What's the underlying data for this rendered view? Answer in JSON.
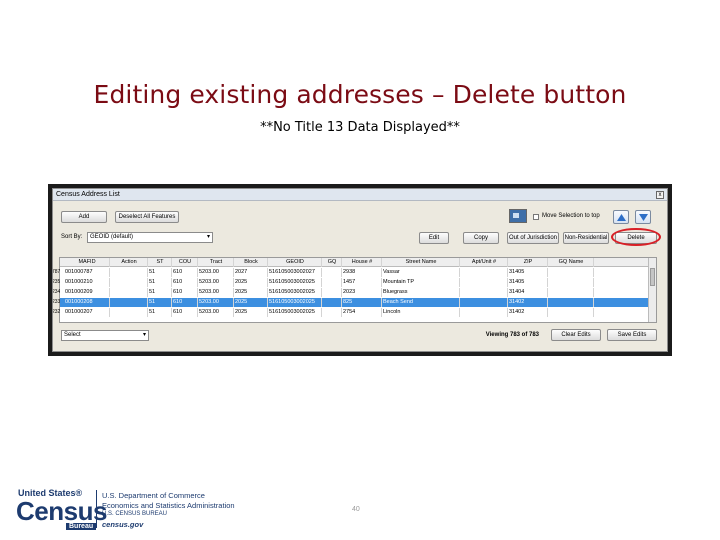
{
  "slide": {
    "title": "Editing existing addresses – Delete button",
    "subtitle": "**No Title 13 Data Displayed**",
    "page_number": "40"
  },
  "window": {
    "title": "Census Address List",
    "close_glyph": "x"
  },
  "toolbar": {
    "add_label": "Add",
    "deselect_label": "Deselect All Features",
    "move_to_top_label": "Move Selection to top",
    "sort_by_label": "Sort By:",
    "sort_by_value": "GEOID (default)",
    "edit_label": "Edit",
    "copy_label": "Copy",
    "out_of_jurisdiction_label": "Out of Jurisdiction",
    "non_residential_label": "Non-Residential",
    "delete_label": "Delete"
  },
  "grid": {
    "columns": [
      "MAFID",
      "Action",
      "ST",
      "COU",
      "Tract",
      "Block",
      "GEOID",
      "GQ",
      "House #",
      "Street Name",
      "Apt/Unit #",
      "ZIP",
      "GQ Name"
    ],
    "rows": [
      {
        "num": "787",
        "cells": [
          "001000787",
          "",
          "51",
          "610",
          "5203.00",
          "2027",
          "516105003002027",
          "",
          "2938",
          "Vassar",
          "",
          "31405",
          ""
        ],
        "selected": false
      },
      {
        "num": "235",
        "cells": [
          "001000210",
          "",
          "51",
          "610",
          "5203.00",
          "2025",
          "516105003002025",
          "",
          "1457",
          "Mountain TP",
          "",
          "31405",
          ""
        ],
        "selected": false
      },
      {
        "num": "234",
        "cells": [
          "001000209",
          "",
          "51",
          "610",
          "5203.00",
          "2025",
          "516105003002025",
          "",
          "2023",
          "Bluegrass",
          "",
          "31404",
          ""
        ],
        "selected": false
      },
      {
        "num": "233",
        "cells": [
          "001000208",
          "",
          "51",
          "610",
          "5203.00",
          "2025",
          "516105003002025",
          "",
          "825",
          "Beach Send",
          "",
          "31402",
          ""
        ],
        "selected": true
      },
      {
        "num": "232",
        "cells": [
          "001000207",
          "",
          "51",
          "610",
          "5203.00",
          "2025",
          "516105003002025",
          "",
          "2754",
          "Lincoln",
          "",
          "31402",
          ""
        ],
        "selected": false
      }
    ]
  },
  "bottombar": {
    "select_value": "Select",
    "viewing_text": "Viewing 783 of 783",
    "clear_edits_label": "Clear Edits",
    "save_edits_label": "Save Edits"
  },
  "footer": {
    "logo_top": "United States®",
    "logo_big": "Census",
    "logo_bureau": "Bureau",
    "dept_line1": "U.S. Department of Commerce",
    "dept_line2": "Economics and Statistics Administration",
    "dept_line3": "U.S. CENSUS BUREAU",
    "dept_line4": "census.gov"
  },
  "colors": {
    "title": "#7b0b14",
    "selected_row": "#3c8fe0",
    "highlight_ring": "#d81f26",
    "logo": "#1d3b6f"
  }
}
